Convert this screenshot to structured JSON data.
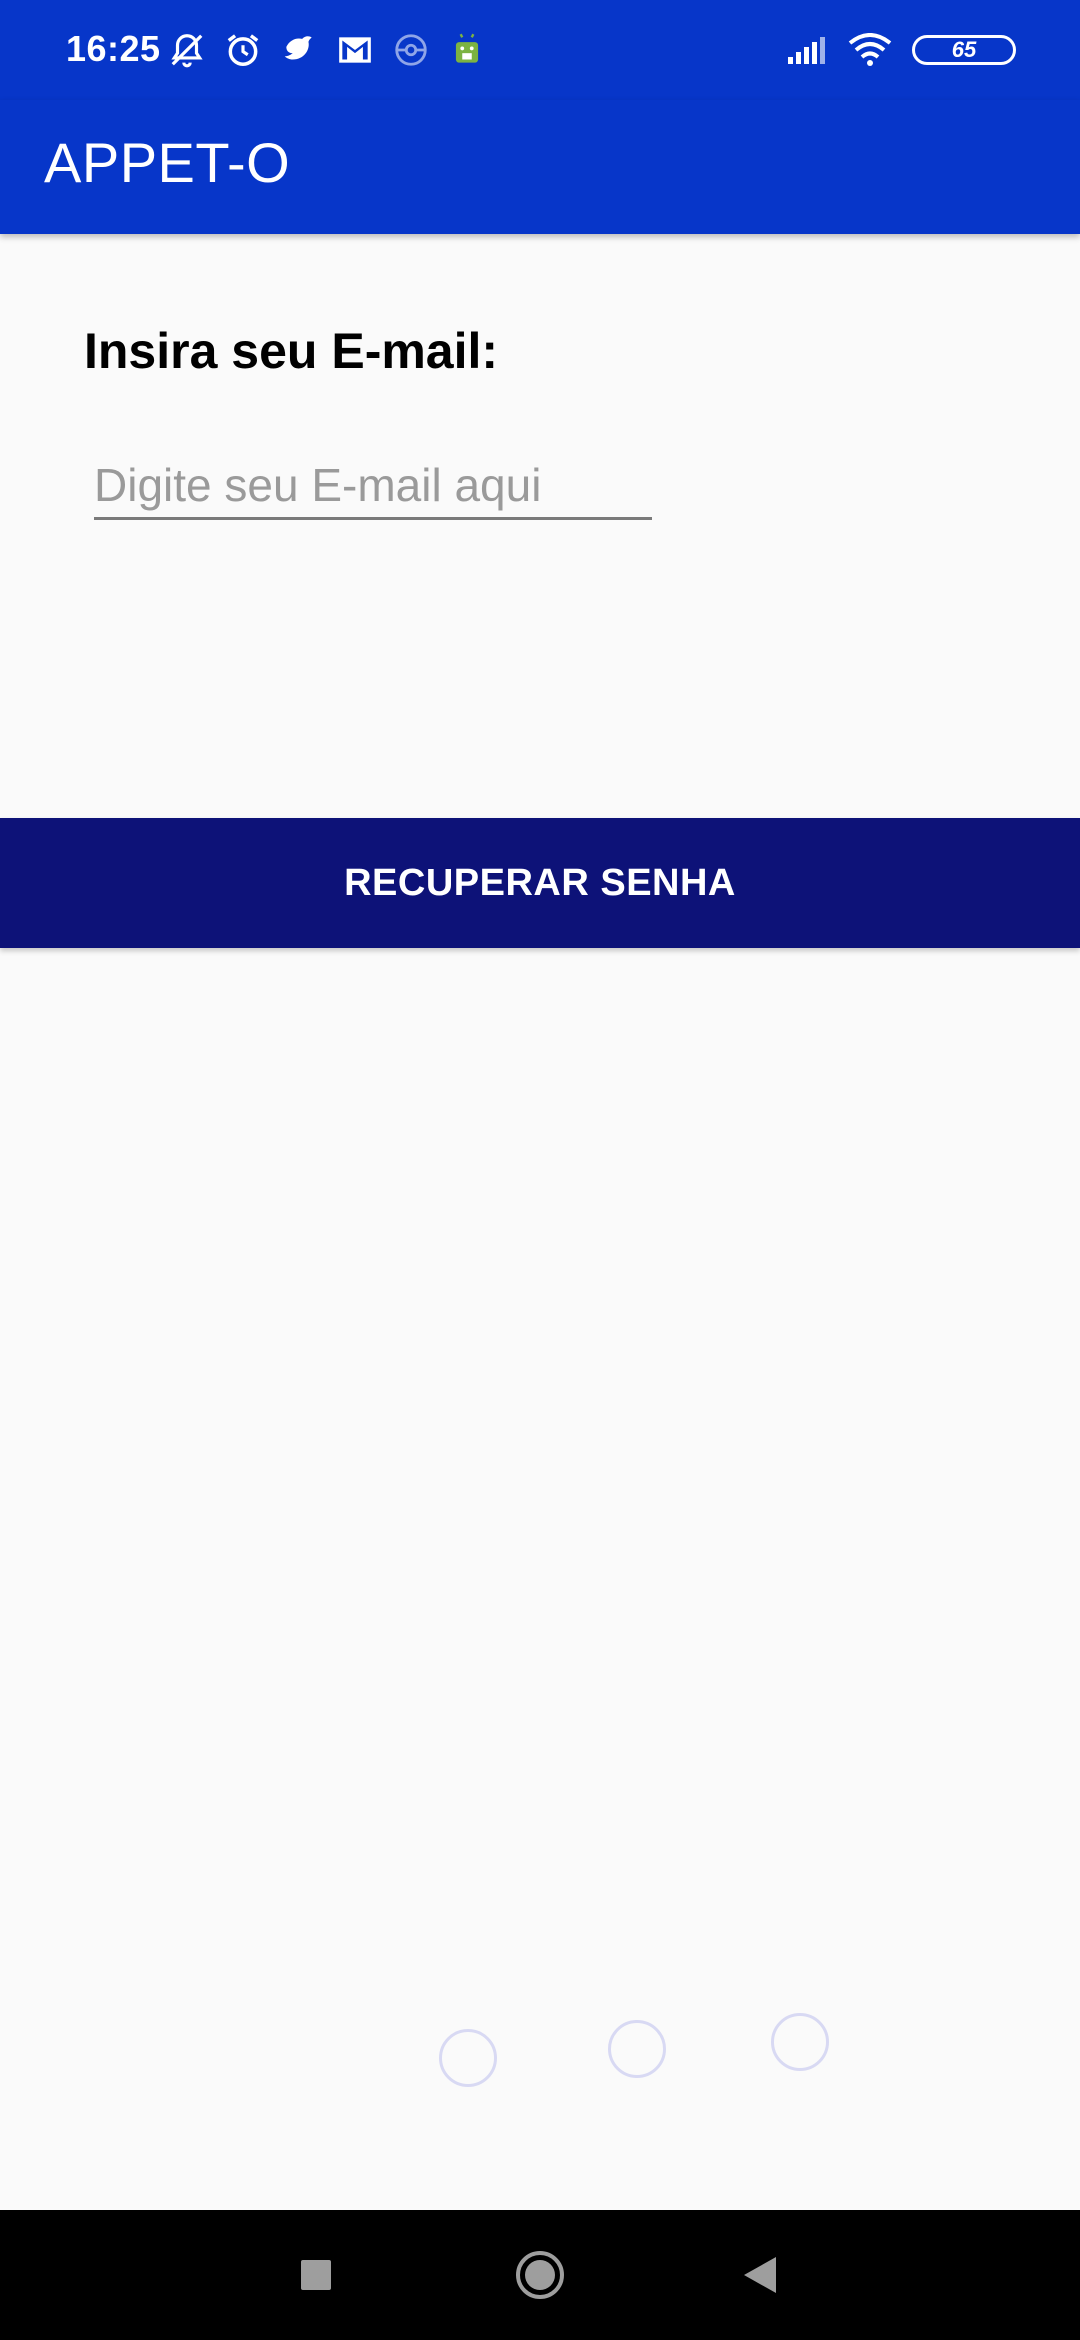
{
  "status_bar": {
    "time": "16:25",
    "battery_level": "65",
    "left_icons": [
      "muted-notification-icon",
      "alarm-icon",
      "bird-app-icon",
      "gmail-icon",
      "pokeball-icon",
      "android-icon"
    ],
    "right_icons": [
      "signal-icon",
      "wifi-icon",
      "battery-icon"
    ]
  },
  "app_bar": {
    "title": "APPET-O"
  },
  "form": {
    "email_label": "Insira seu E-mail:",
    "email_placeholder": "Digite seu E-mail aqui",
    "email_value": "",
    "submit_label": "RECUPERAR SENHA"
  },
  "loading_indicator": {
    "dot_count": 3,
    "color": "#d8d9f3"
  },
  "nav_bar": {
    "buttons": [
      "recents-button",
      "home-button",
      "back-button"
    ]
  },
  "colors": {
    "primary": "#0736c9",
    "button": "#0d1278",
    "background": "#fafafa"
  }
}
